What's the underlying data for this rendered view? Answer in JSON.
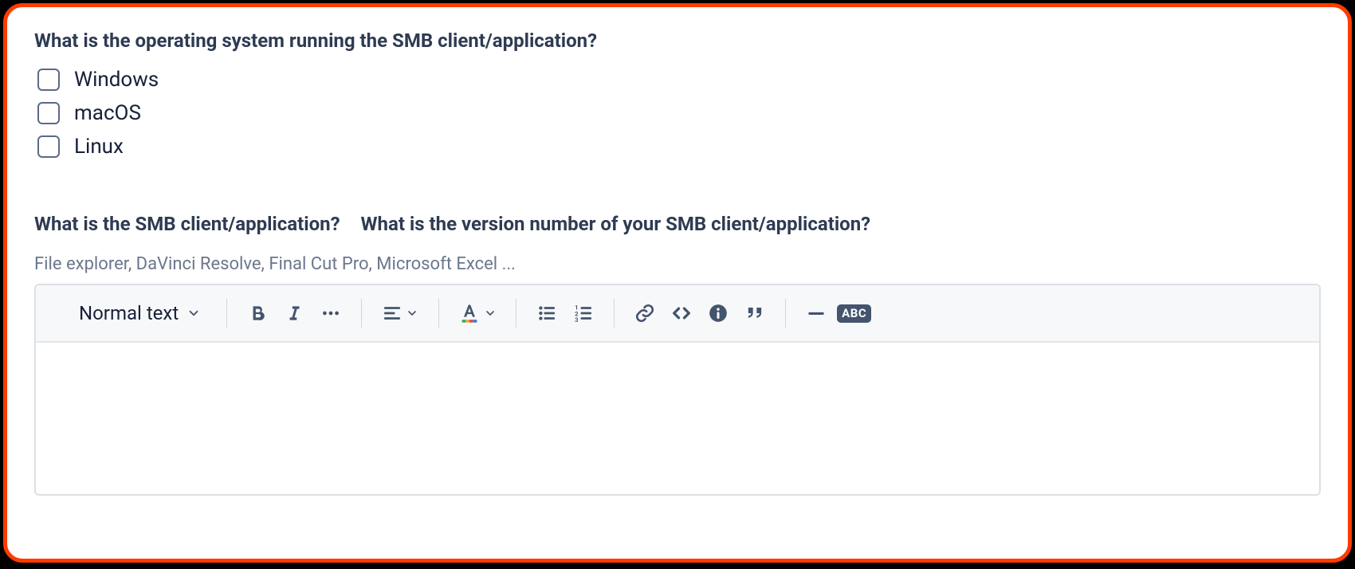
{
  "questions": {
    "os": {
      "label": "What is the operating system running the SMB client/application?",
      "options": [
        "Windows",
        "macOS",
        "Linux"
      ]
    },
    "client": {
      "label": "What is the SMB client/application?"
    },
    "version": {
      "label": "What is the version number of your SMB client/application?"
    }
  },
  "hint": "File explorer, DaVinci Resolve, Final Cut Pro, Microsoft Excel ...",
  "toolbar": {
    "text_style": "Normal text",
    "abc": "ABC"
  }
}
